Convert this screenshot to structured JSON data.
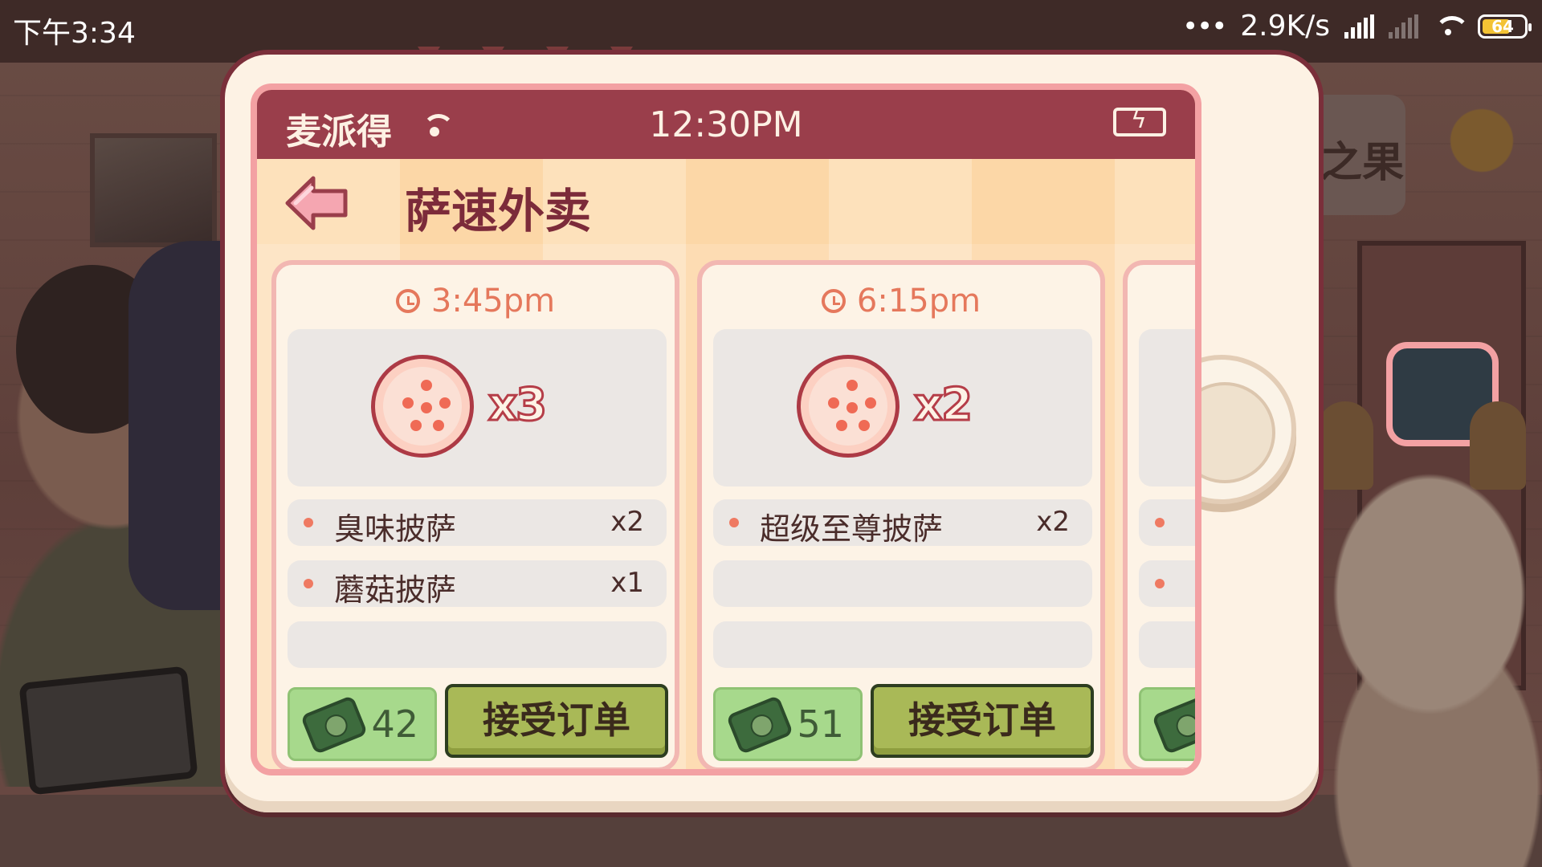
{
  "status_bar": {
    "time": "下午3:34",
    "network_speed": "2.9K/s",
    "battery": "64",
    "more": "•••",
    "icons": [
      "signal-icon",
      "signal-dim-icon",
      "wifi-icon",
      "battery-icon"
    ]
  },
  "phone": {
    "carrier": "麦派得",
    "clock": "12:30PM",
    "icons": [
      "signal-icon",
      "charging-battery-icon"
    ]
  },
  "app": {
    "title": "萨速外卖",
    "back_icon": "arrow-left-icon"
  },
  "orders": [
    {
      "time": "3:45pm",
      "pizza_qty": "x3",
      "items": [
        {
          "name": "臭味披萨",
          "count": "x2"
        },
        {
          "name": "蘑菇披萨",
          "count": "x1"
        }
      ],
      "payment": "42",
      "accept_label": "接受订单"
    },
    {
      "time": "6:15pm",
      "pizza_qty": "x2",
      "items": [
        {
          "name": "超级至尊披萨",
          "count": "x2"
        }
      ],
      "payment": "51",
      "accept_label": "接受订单"
    }
  ],
  "background": {
    "sign_text": "之果"
  },
  "colors": {
    "header_bar": "#9a3e4b",
    "accept_button": "#a9b957",
    "payment_box": "#a7d98c",
    "accent_time": "#e5785c"
  }
}
